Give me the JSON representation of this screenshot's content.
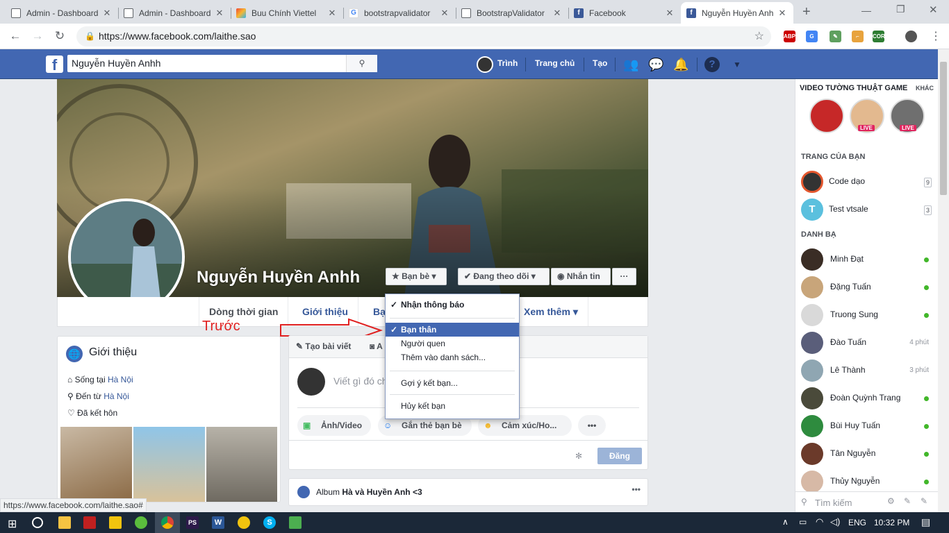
{
  "browser": {
    "tabs": [
      {
        "title": "Admin - Dashboard",
        "favicon": "doc-icon"
      },
      {
        "title": "Admin - Dashboard",
        "favicon": "doc-icon"
      },
      {
        "title": "Buu Chính Viettel",
        "favicon": "viettel-icon"
      },
      {
        "title": "bootstrapvalidator",
        "favicon": "google-icon"
      },
      {
        "title": "BootstrapValidator",
        "favicon": "doc-icon"
      },
      {
        "title": "Facebook",
        "favicon": "facebook-icon"
      },
      {
        "title": "Nguyễn Huyền Anh",
        "favicon": "facebook-icon",
        "active": true
      }
    ],
    "url": "https://www.facebook.com/laithe.sao",
    "status_url": "https://www.facebook.com/laithe.sao#"
  },
  "fb_header": {
    "search_value": "Nguyễn Huyền Anhh",
    "user_name": "Trình",
    "home": "Trang chủ",
    "create": "Tạo"
  },
  "profile": {
    "name": "Nguyễn Huyền Anhh",
    "buttons": {
      "friends": "Bạn bè",
      "following": "Đang theo dõi",
      "message": "Nhắn tin",
      "more": "···"
    },
    "tabs": [
      "Dòng thời gian",
      "Giới thiệu",
      "Bạ",
      "Xem thêm"
    ]
  },
  "dropdown": {
    "items": [
      {
        "label": "Nhận thông báo",
        "checked": true,
        "bold": true
      },
      {
        "label": "Bạn thân",
        "checked": true,
        "selected": true
      },
      {
        "label": "Người quen"
      },
      {
        "label": "Thêm vào danh sách..."
      },
      {
        "label": "Gợi ý kết bạn..."
      },
      {
        "label": "Hủy kết bạn"
      }
    ]
  },
  "annotation": {
    "text": "Trước",
    "color": "#e02020"
  },
  "intro": {
    "title": "Giới thiệu",
    "lives_in_prefix": "Sống tại",
    "lives_in": "Hà Nội",
    "from_prefix": "Đến từ",
    "from": "Hà Nội",
    "relationship": "Đã kết hôn"
  },
  "composer": {
    "tab_create": "Tạo bài viết",
    "tab_photo": "A",
    "placeholder": "Viết gì đó ch",
    "photo_video": "Ảnh/Video",
    "tag_friends": "Gắn thẻ bạn bè",
    "feeling": "Cảm xúc/Ho...",
    "post": "Đăng"
  },
  "album": {
    "prefix": "Album",
    "title": "Hà và Huyền Anh <3"
  },
  "sidebar": {
    "games_title": "VIDEO TƯỜNG THUẬT GAME",
    "games_more": "KHÁC",
    "live": "LIVE",
    "pages_title": "TRANG CỦA BẠN",
    "pages": [
      {
        "name": "Code dạo",
        "count": "9"
      },
      {
        "name": "Test vtsale",
        "count": "3"
      }
    ],
    "contacts_title": "DANH BẠ",
    "contacts": [
      {
        "name": "Minh Đạt",
        "status": "online"
      },
      {
        "name": "Đặng Tuấn",
        "status": "online"
      },
      {
        "name": "Truong Sung",
        "status": "online"
      },
      {
        "name": "Đào Tuấn",
        "time": "4 phút"
      },
      {
        "name": "Lê Thành",
        "time": "3 phút"
      },
      {
        "name": "Đoàn Quỳnh Trang",
        "status": "online"
      },
      {
        "name": "Bùi Huy Tuấn",
        "status": "online"
      },
      {
        "name": "Tân Nguyễn",
        "status": "online"
      },
      {
        "name": "Thủy Nguyễn",
        "status": "online"
      }
    ],
    "search_placeholder": "Tìm kiếm"
  },
  "taskbar": {
    "lang": "ENG",
    "time": "10:32 PM"
  },
  "colors": {
    "fb_blue": "#4267b2",
    "online": "#42b72a",
    "link": "#365899"
  }
}
